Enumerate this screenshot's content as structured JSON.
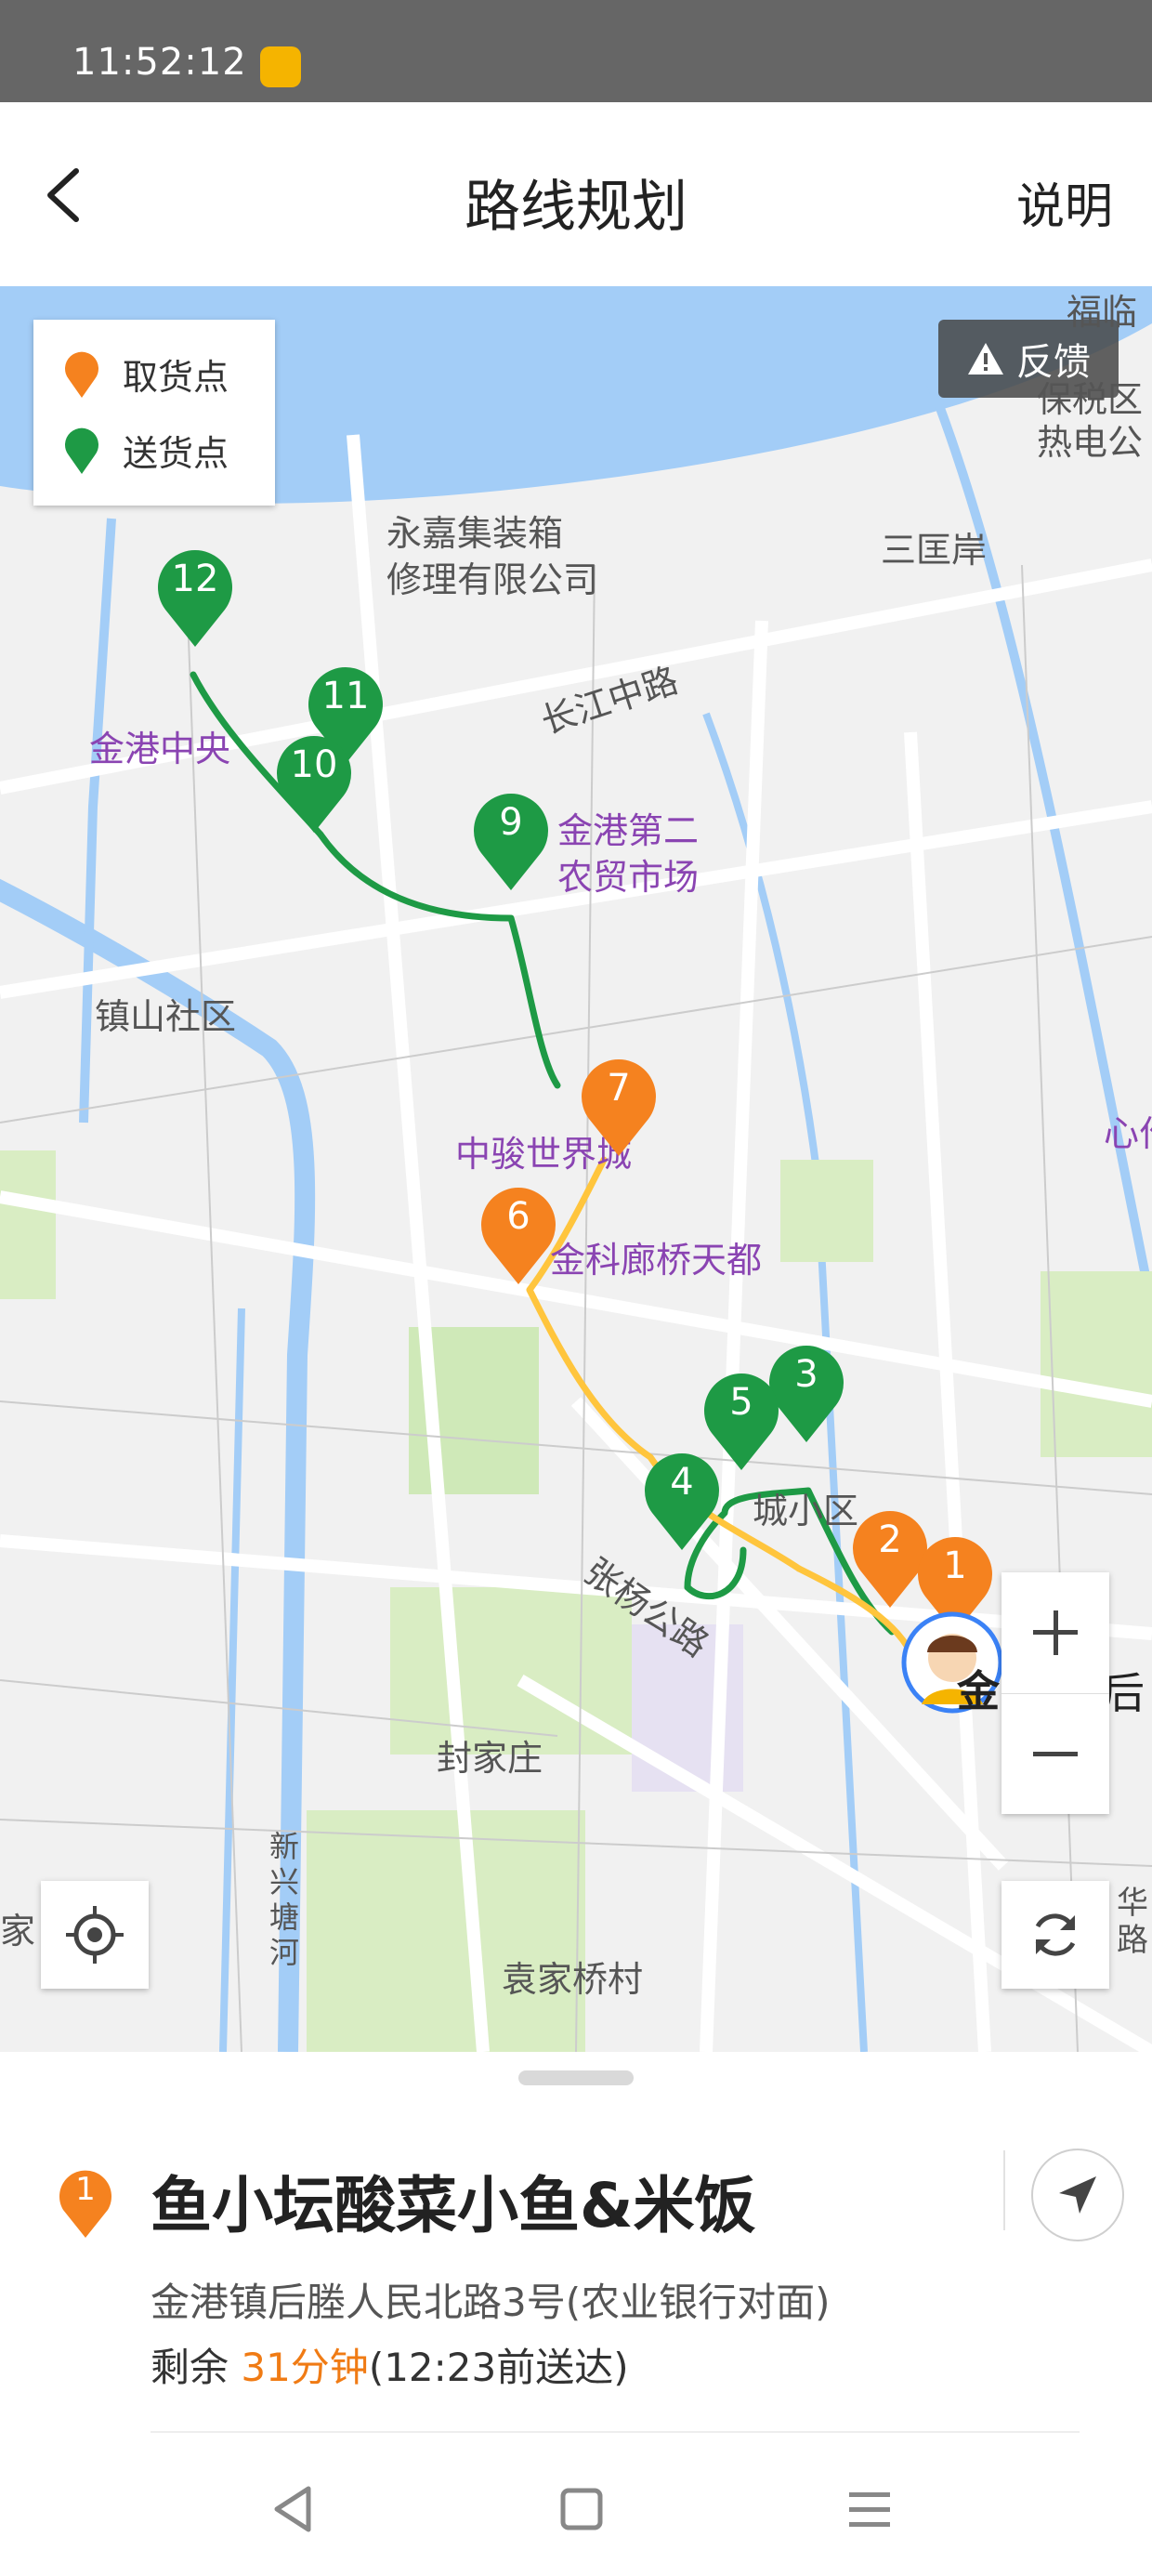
{
  "status_bar": {
    "time": "11:52:12"
  },
  "header": {
    "title": "路线规划",
    "help_label": "说明"
  },
  "legend": {
    "pickup_label": "取货点",
    "delivery_label": "送货点",
    "pickup_color": "#f5821f",
    "delivery_color": "#1e9a45"
  },
  "feedback_label": "反馈",
  "route_colors": {
    "delivery_route": "#1e9a45",
    "pickup_route": "#ffc53d"
  },
  "map_labels": {
    "fulin": "福临",
    "baoshui": "保税区",
    "redian": "热电公",
    "yongjia": "永嘉集装箱",
    "yongjia2": "修理有限公司",
    "sankuang": "三匡岸",
    "changjiang": "长江中路",
    "jingang_central": "金港中央",
    "jingang_market": "金港第二",
    "jingang_market2": "农贸市场",
    "zhenshan": "镇山社区",
    "zhongjun": "中骏世界城",
    "xinzuo": "心作",
    "langqiao": "金科廊桥天都",
    "chengxiaoqu": "城小区",
    "zhangyang": "张杨公路",
    "fengjiazhuang": "封家庄",
    "xinxingtang": "新兴塘河",
    "yuanjiaqiao": "袁家桥村",
    "jia": "家",
    "hua_road": "华路",
    "rider_a": "金",
    "rider_b": "后"
  },
  "markers": {
    "m1": "1",
    "m2": "2",
    "m3": "3",
    "m4": "4",
    "m5": "5",
    "m6": "6",
    "m7": "7",
    "m9": "9",
    "m10": "10",
    "m11": "11",
    "m12": "12"
  },
  "order": {
    "index": "1",
    "title": "鱼小坛酸菜小鱼&米饭",
    "address": "金港镇后塍人民北路3号(农业银行对面)",
    "remain_prefix": "剩余 ",
    "remain_time": "31分钟",
    "remain_suffix": "(12:23前送达)"
  },
  "icons": {
    "back": "chevron-left-icon",
    "warn": "warning-icon",
    "zoom_in": "plus-icon",
    "zoom_out": "minus-icon",
    "locate": "crosshair-icon",
    "refresh": "refresh-icon",
    "navigate": "navigation-arrow-icon"
  }
}
